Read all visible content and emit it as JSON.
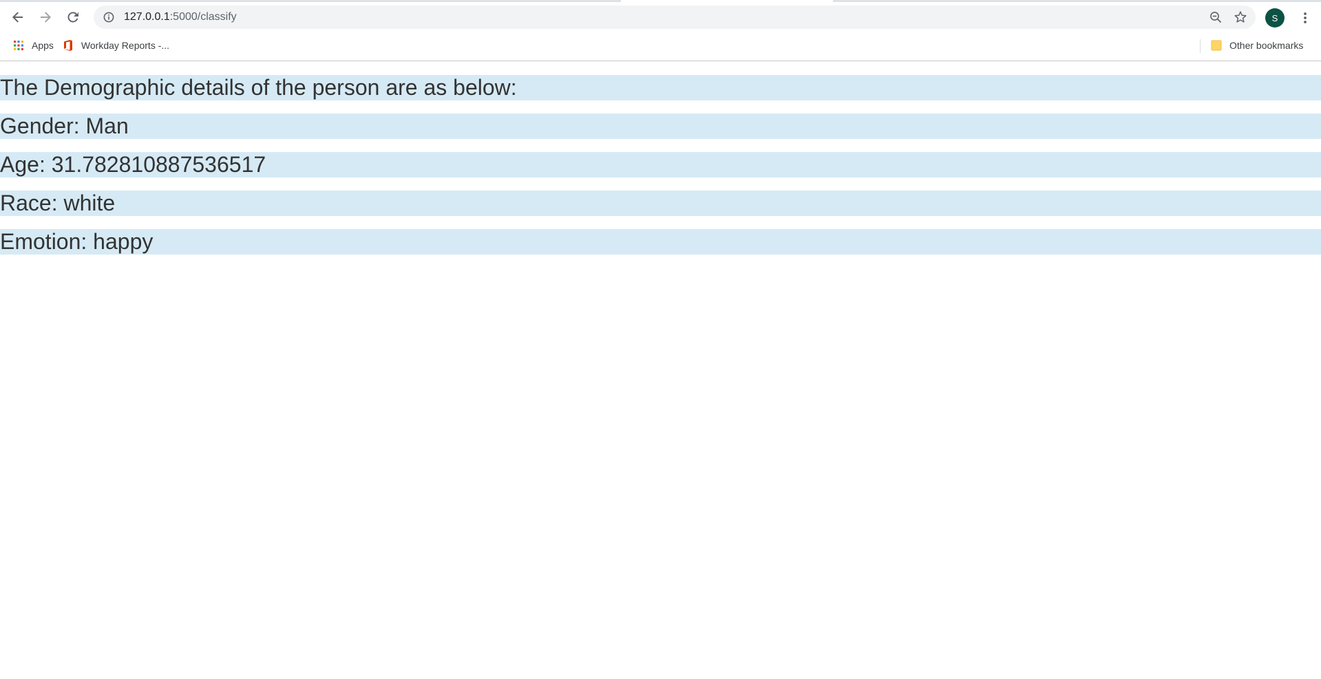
{
  "browser": {
    "url_host": "127.0.0.1",
    "url_path": ":5000/classify",
    "profile_initial": "S",
    "icons": {
      "back": "back-arrow-icon",
      "forward": "forward-arrow-icon",
      "reload": "reload-icon",
      "site_info": "info-icon",
      "zoom": "zoom-out-icon",
      "bookmark_star": "star-icon",
      "menu": "kebab-menu-icon"
    }
  },
  "bookmarks": {
    "items": [
      {
        "label": "Apps",
        "icon": "apps-grid-icon"
      },
      {
        "label": "Workday Reports -...",
        "icon": "office-logo-icon"
      }
    ],
    "other": {
      "label": "Other bookmarks",
      "icon": "folder-icon"
    }
  },
  "page": {
    "heading": "The Demographic details of the person are as below:",
    "gender": "Gender: Man",
    "age": "Age: 31.782810887536517",
    "race": "Race: white",
    "emotion": "Emotion: happy"
  },
  "colors": {
    "highlight": "#d6eaf5",
    "text": "#333333",
    "profile": "#0b5345"
  }
}
